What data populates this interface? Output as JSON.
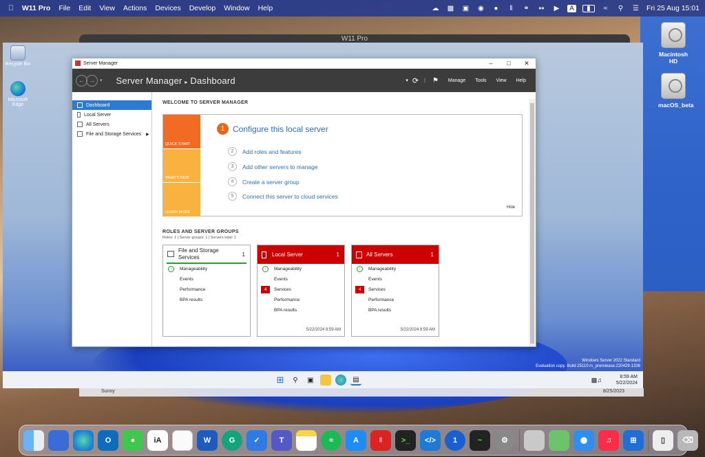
{
  "mac_menubar": {
    "app_name": "W11 Pro",
    "menus": [
      "File",
      "Edit",
      "View",
      "Actions",
      "Devices",
      "Develop",
      "Window",
      "Help"
    ],
    "clock": "Fri 25 Aug  15:01"
  },
  "mac_desktop": {
    "disks": [
      "Macintosh HD",
      "macOS_beta"
    ]
  },
  "vm": {
    "title": "W11 Pro",
    "weather": "Sunny",
    "host_date": "8/25/2023"
  },
  "win_desktop": {
    "icons": [
      "Recycle Bin",
      "Microsoft Edge"
    ],
    "watermark": [
      "Windows Server 2022 Standard",
      "Evaluation copy. Build 25110.rs_prerelease.220429-1336"
    ],
    "clock_time": "8:59 AM",
    "clock_date": "5/22/2024"
  },
  "server_manager": {
    "window_title": "Server Manager",
    "breadcrumb_root": "Server Manager",
    "breadcrumb_sep": "▸",
    "breadcrumb_page": "Dashboard",
    "menu": [
      "Manage",
      "Tools",
      "View",
      "Help"
    ],
    "nav": [
      "Dashboard",
      "Local Server",
      "All Servers",
      "File and Storage Services"
    ],
    "welcome_heading": "WELCOME TO SERVER MANAGER",
    "quick_tiles": [
      "QUICK START",
      "WHAT'S NEW",
      "LEARN MORE"
    ],
    "configure_num": "1",
    "configure_label": "Configure this local server",
    "steps": [
      {
        "num": "2",
        "label": "Add roles and features"
      },
      {
        "num": "3",
        "label": "Add other servers to manage"
      },
      {
        "num": "4",
        "label": "Create a server group"
      },
      {
        "num": "5",
        "label": "Connect this server to cloud services"
      }
    ],
    "hide_label": "Hide",
    "roles_heading": "ROLES AND SERVER GROUPS",
    "roles_summary": "Roles: 1   |   Server groups: 1   |   Servers total: 1",
    "cards": [
      {
        "title": "File and Storage Services",
        "count": "1",
        "rows": [
          "Manageability",
          "Events",
          "Performance",
          "BPA results"
        ],
        "services_badge": "",
        "timestamp": ""
      },
      {
        "title": "Local Server",
        "count": "1",
        "rows": [
          "Manageability",
          "Events",
          "Services",
          "Performance",
          "BPA results"
        ],
        "services_badge": "4",
        "timestamp": "5/22/2024 8:59 AM"
      },
      {
        "title": "All Servers",
        "count": "1",
        "rows": [
          "Manageability",
          "Events",
          "Services",
          "Performance",
          "BPA results"
        ],
        "services_badge": "4",
        "timestamp": "5/22/2024 8:59 AM"
      }
    ],
    "colors": {
      "accent": "#2d7bd0",
      "tile_orange": "#f26b22",
      "tile_yellow": "#f9b140",
      "red": "#cc0000",
      "link": "#2e6fb7"
    }
  },
  "dock_icons": [
    "finder-icon",
    "launchpad-icon",
    "edge-icon",
    "outlook-icon",
    "messages-icon",
    "ia-writer-icon",
    "notes-blank-icon",
    "word-icon",
    "grammarly-icon",
    "tasks-icon",
    "teams-icon",
    "notes-icon",
    "spotify-icon",
    "app-store-icon",
    "parallels-icon",
    "terminal-icon",
    "vscode-icon",
    "1password-icon",
    "activity-monitor-icon",
    "system-settings-icon",
    "preview-icon",
    "maps-icon",
    "safari-icon",
    "music-icon",
    "windows-icon",
    "folder-icon",
    "trash-icon"
  ]
}
